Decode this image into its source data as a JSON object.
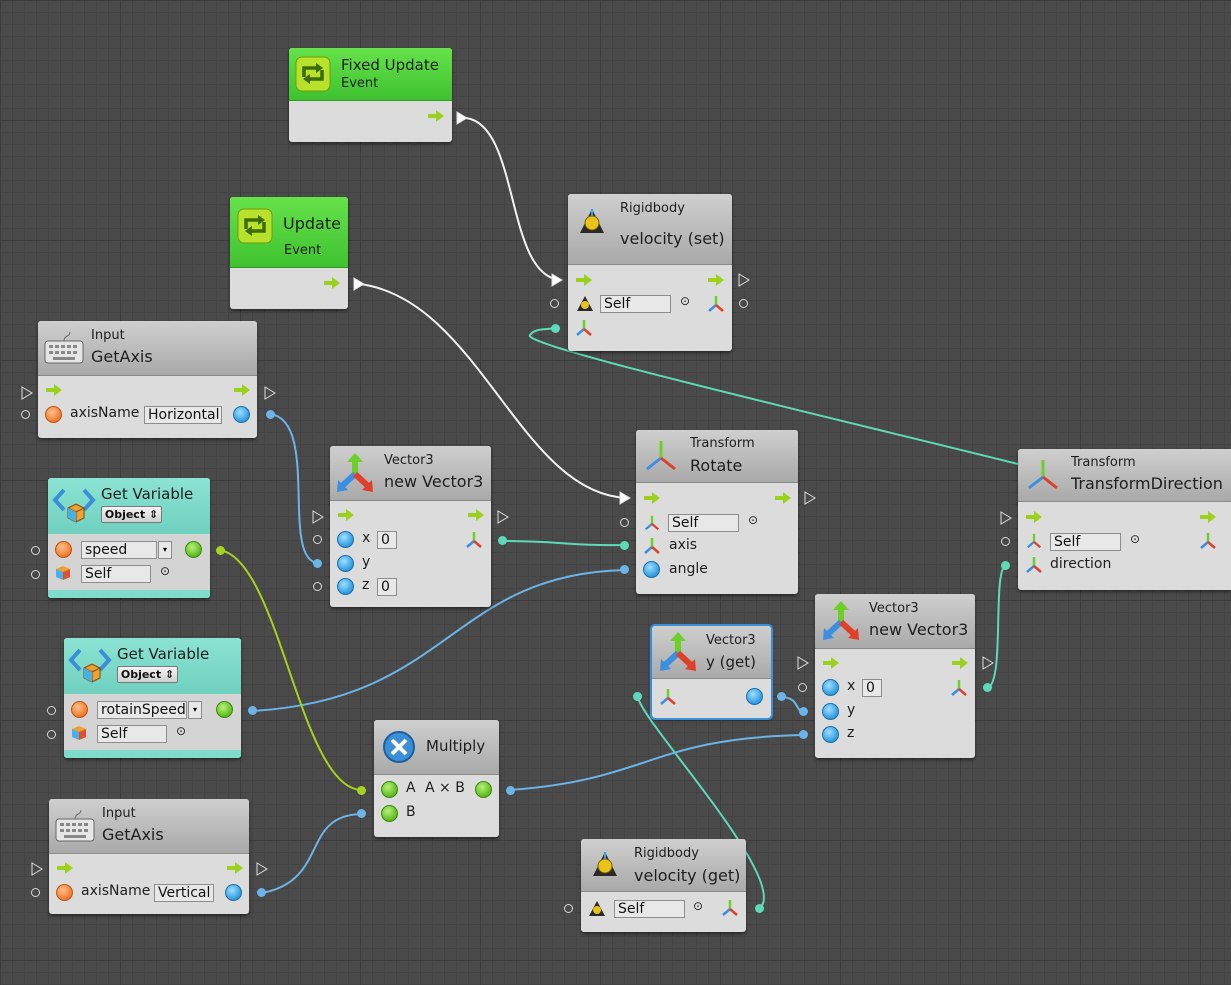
{
  "nodes": {
    "fixed_update": {
      "title": "Fixed Update",
      "subtitle": "Event"
    },
    "update": {
      "title": "Update",
      "subtitle": "Event"
    },
    "rb_velocity_set": {
      "category": "Rigidbody",
      "title": "velocity (set)",
      "target": "Self"
    },
    "input_getaxis_h": {
      "category": "Input",
      "title": "GetAxis",
      "param_label": "axisName",
      "param_value": "Horizontal"
    },
    "get_var_speed": {
      "title": "Get Variable",
      "kind": "Object",
      "var_name": "speed",
      "target": "Self"
    },
    "vector3_new_1": {
      "category": "Vector3",
      "title": "new Vector3",
      "x_label": "x",
      "x_value": "0",
      "y_label": "y",
      "z_label": "z",
      "z_value": "0"
    },
    "transform_rotate": {
      "category": "Transform",
      "title": "Rotate",
      "target": "Self",
      "axis_label": "axis",
      "angle_label": "angle"
    },
    "transform_direction": {
      "category": "Transform",
      "title": "TransformDirection",
      "target": "Self",
      "direction_label": "direction"
    },
    "get_var_rotain": {
      "title": "Get Variable",
      "kind": "Object",
      "var_name": "rotainSpeed",
      "target": "Self"
    },
    "vector3_y_get": {
      "category": "Vector3",
      "title": "y (get)"
    },
    "vector3_new_2": {
      "category": "Vector3",
      "title": "new Vector3",
      "x_label": "x",
      "x_value": "0",
      "y_label": "y",
      "z_label": "z"
    },
    "multiply": {
      "title": "Multiply",
      "a_label": "A",
      "out_label": "A × B",
      "b_label": "B"
    },
    "input_getaxis_v": {
      "category": "Input",
      "title": "GetAxis",
      "param_label": "axisName",
      "param_value": "Vertical"
    },
    "rb_velocity_get": {
      "category": "Rigidbody",
      "title": "velocity (get)",
      "target": "Self"
    }
  },
  "colors": {
    "event_green": "#4fd13a",
    "variable_teal": "#7fdccb",
    "wire_flow": "#ffffff",
    "wire_vector": "#5fd9b7",
    "wire_float": "#6cb4e8",
    "wire_object": "#a8d020",
    "selection": "#3a8fd8"
  },
  "icons": {
    "event": "loop-arrow-icon",
    "rigidbody": "rigidbody-icon",
    "transform": "axes-icon",
    "vector3": "vector-arrows-icon",
    "input": "keyboard-icon",
    "variable": "code-brackets-icon",
    "multiply": "multiply-icon"
  }
}
